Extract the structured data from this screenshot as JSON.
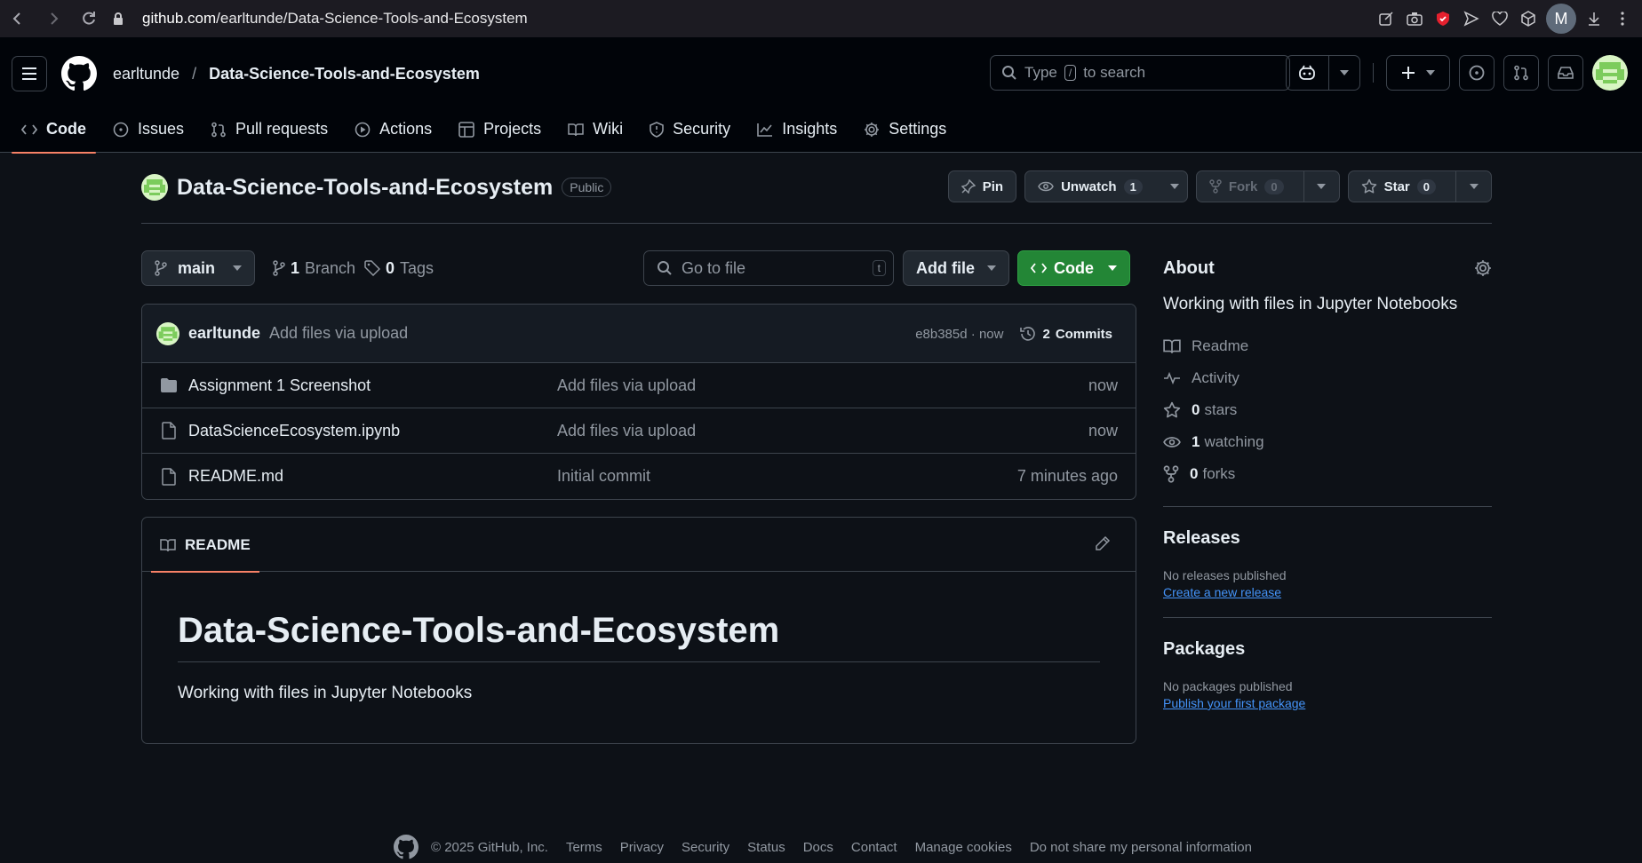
{
  "browser": {
    "url_host": "github.com",
    "url_path": "/earltunde/Data-Science-Tools-and-Ecosystem",
    "profile_initial": "M"
  },
  "header": {
    "owner": "earltunde",
    "separator": "/",
    "repo": "Data-Science-Tools-and-Ecosystem",
    "search_prefix": "Type",
    "search_key": "/",
    "search_suffix": "to search"
  },
  "tabs": [
    {
      "label": "Code",
      "icon": "code-icon"
    },
    {
      "label": "Issues",
      "icon": "issue-icon"
    },
    {
      "label": "Pull requests",
      "icon": "pull-request-icon"
    },
    {
      "label": "Actions",
      "icon": "play-icon"
    },
    {
      "label": "Projects",
      "icon": "table-icon"
    },
    {
      "label": "Wiki",
      "icon": "book-icon"
    },
    {
      "label": "Security",
      "icon": "shield-icon"
    },
    {
      "label": "Insights",
      "icon": "graph-icon"
    },
    {
      "label": "Settings",
      "icon": "gear-icon"
    }
  ],
  "repo": {
    "name": "Data-Science-Tools-and-Ecosystem",
    "visibility": "Public",
    "pin_label": "Pin",
    "watch_label": "Unwatch",
    "watch_count": "1",
    "fork_label": "Fork",
    "fork_count": "0",
    "star_label": "Star",
    "star_count": "0"
  },
  "toolbar": {
    "branch": "main",
    "branch_count": "1",
    "branch_label": "Branch",
    "tag_count": "0",
    "tag_label": "Tags",
    "goto_placeholder": "Go to file",
    "goto_key": "t",
    "add_file_label": "Add file",
    "code_label": "Code"
  },
  "commit": {
    "author": "earltunde",
    "message": "Add files via upload",
    "hash": "e8b385d",
    "dot": "·",
    "time": "now",
    "commits_count": "2",
    "commits_label": "Commits"
  },
  "files": [
    {
      "type": "folder",
      "name": "Assignment 1 Screenshot",
      "message": "Add files via upload",
      "time": "now"
    },
    {
      "type": "file",
      "name": "DataScienceEcosystem.ipynb",
      "message": "Add files via upload",
      "time": "now"
    },
    {
      "type": "file",
      "name": "README.md",
      "message": "Initial commit",
      "time": "7 minutes ago"
    }
  ],
  "readme": {
    "tab_label": "README",
    "h1": "Data-Science-Tools-and-Ecosystem",
    "paragraph": "Working with files in Jupyter Notebooks"
  },
  "about": {
    "title": "About",
    "description": "Working with files in Jupyter Notebooks",
    "readme_label": "Readme",
    "activity_label": "Activity",
    "stars_count": "0",
    "stars_label": "stars",
    "watching_count": "1",
    "watching_label": "watching",
    "forks_count": "0",
    "forks_label": "forks"
  },
  "releases": {
    "title": "Releases",
    "empty": "No releases published",
    "link": "Create a new release"
  },
  "packages": {
    "title": "Packages",
    "empty": "No packages published",
    "link": "Publish your first package"
  },
  "footer": {
    "copyright": "© 2025 GitHub, Inc.",
    "links": [
      "Terms",
      "Privacy",
      "Security",
      "Status",
      "Docs",
      "Contact",
      "Manage cookies",
      "Do not share my personal information"
    ]
  },
  "colors": {
    "accent_underline": "#f78166",
    "code_button": "#238636",
    "link": "#4493f8",
    "background": "#0d1117"
  }
}
